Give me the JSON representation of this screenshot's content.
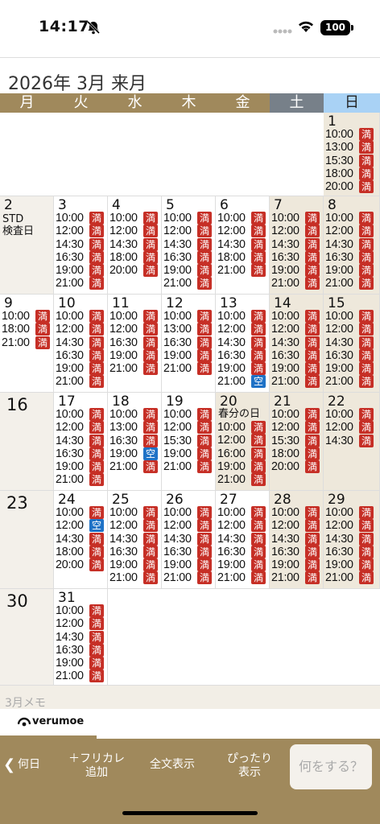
{
  "status_bar": {
    "time": "14:17",
    "battery": "100"
  },
  "calendar": {
    "title": "2026年 3月 来月",
    "weekdays": [
      "月",
      "火",
      "水",
      "木",
      "金",
      "土",
      "日"
    ],
    "weeks": [
      [
        null,
        null,
        null,
        null,
        null,
        null,
        {
          "day": "1",
          "slots": [
            [
              "10:00",
              "満"
            ],
            [
              "13:00",
              "満"
            ],
            [
              "15:30",
              "満"
            ],
            [
              "18:00",
              "満"
            ],
            [
              "20:00",
              "満"
            ]
          ]
        }
      ],
      [
        {
          "day": "2",
          "note": "STD\n検査日",
          "slots": []
        },
        {
          "day": "3",
          "slots": [
            [
              "10:00",
              "満"
            ],
            [
              "12:00",
              "満"
            ],
            [
              "14:30",
              "満"
            ],
            [
              "16:30",
              "満"
            ],
            [
              "19:00",
              "満"
            ],
            [
              "21:00",
              "満"
            ]
          ]
        },
        {
          "day": "4",
          "slots": [
            [
              "10:00",
              "満"
            ],
            [
              "12:00",
              "満"
            ],
            [
              "14:30",
              "満"
            ],
            [
              "18:00",
              "満"
            ],
            [
              "20:00",
              "満"
            ]
          ]
        },
        {
          "day": "5",
          "slots": [
            [
              "10:00",
              "満"
            ],
            [
              "12:00",
              "満"
            ],
            [
              "14:30",
              "満"
            ],
            [
              "16:30",
              "満"
            ],
            [
              "19:00",
              "満"
            ],
            [
              "21:00",
              "満"
            ]
          ]
        },
        {
          "day": "6",
          "slots": [
            [
              "10:00",
              "満"
            ],
            [
              "12:00",
              "満"
            ],
            [
              "14:30",
              "満"
            ],
            [
              "18:00",
              "満"
            ],
            [
              "21:00",
              "満"
            ]
          ]
        },
        {
          "day": "7",
          "slots": [
            [
              "10:00",
              "満"
            ],
            [
              "12:00",
              "満"
            ],
            [
              "14:30",
              "満"
            ],
            [
              "16:30",
              "満"
            ],
            [
              "19:00",
              "満"
            ],
            [
              "21:00",
              "満"
            ]
          ]
        },
        {
          "day": "8",
          "slots": [
            [
              "10:00",
              "満"
            ],
            [
              "12:00",
              "満"
            ],
            [
              "14:30",
              "満"
            ],
            [
              "16:30",
              "満"
            ],
            [
              "19:00",
              "満"
            ],
            [
              "21:00",
              "満"
            ]
          ]
        }
      ],
      [
        {
          "day": "9",
          "slots": [
            [
              "10:00",
              "満"
            ],
            [
              "18:00",
              "満"
            ],
            [
              "21:00",
              "満"
            ]
          ]
        },
        {
          "day": "10",
          "slots": [
            [
              "10:00",
              "満"
            ],
            [
              "12:00",
              "満"
            ],
            [
              "14:30",
              "満"
            ],
            [
              "16:30",
              "満"
            ],
            [
              "19:00",
              "満"
            ],
            [
              "21:00",
              "満"
            ]
          ]
        },
        {
          "day": "11",
          "slots": [
            [
              "10:00",
              "満"
            ],
            [
              "12:00",
              "満"
            ],
            [
              "16:30",
              "満"
            ],
            [
              "19:00",
              "満"
            ],
            [
              "21:00",
              "満"
            ]
          ]
        },
        {
          "day": "12",
          "slots": [
            [
              "10:00",
              "満"
            ],
            [
              "13:00",
              "満"
            ],
            [
              "16:30",
              "満"
            ],
            [
              "19:00",
              "満"
            ],
            [
              "21:00",
              "満"
            ]
          ]
        },
        {
          "day": "13",
          "slots": [
            [
              "10:00",
              "満"
            ],
            [
              "12:00",
              "満"
            ],
            [
              "14:30",
              "満"
            ],
            [
              "16:30",
              "満"
            ],
            [
              "19:00",
              "満"
            ],
            [
              "21:00",
              "空"
            ]
          ]
        },
        {
          "day": "14",
          "slots": [
            [
              "10:00",
              "満"
            ],
            [
              "12:00",
              "満"
            ],
            [
              "14:30",
              "満"
            ],
            [
              "16:30",
              "満"
            ],
            [
              "19:00",
              "満"
            ],
            [
              "21:00",
              "満"
            ]
          ]
        },
        {
          "day": "15",
          "slots": [
            [
              "10:00",
              "満"
            ],
            [
              "12:00",
              "満"
            ],
            [
              "14:30",
              "満"
            ],
            [
              "16:30",
              "満"
            ],
            [
              "19:00",
              "満"
            ],
            [
              "21:00",
              "満"
            ]
          ]
        }
      ],
      [
        {
          "day": "16",
          "slots": []
        },
        {
          "day": "17",
          "slots": [
            [
              "10:00",
              "満"
            ],
            [
              "12:00",
              "満"
            ],
            [
              "14:30",
              "満"
            ],
            [
              "16:30",
              "満"
            ],
            [
              "19:00",
              "満"
            ],
            [
              "21:00",
              "満"
            ]
          ]
        },
        {
          "day": "18",
          "slots": [
            [
              "10:00",
              "満"
            ],
            [
              "13:00",
              "満"
            ],
            [
              "16:30",
              "満"
            ],
            [
              "19:00",
              "空"
            ],
            [
              "21:00",
              "満"
            ]
          ]
        },
        {
          "day": "19",
          "slots": [
            [
              "10:00",
              "満"
            ],
            [
              "12:00",
              "満"
            ],
            [
              "15:30",
              "満"
            ],
            [
              "19:00",
              "満"
            ],
            [
              "21:00",
              "満"
            ]
          ]
        },
        {
          "day": "20",
          "note": "春分の日",
          "slots": [
            [
              "10:00",
              "満"
            ],
            [
              "12:00",
              "満"
            ],
            [
              "16:00",
              "満"
            ],
            [
              "19:00",
              "満"
            ],
            [
              "21:00",
              "満"
            ]
          ]
        },
        {
          "day": "21",
          "slots": [
            [
              "10:00",
              "満"
            ],
            [
              "12:00",
              "満"
            ],
            [
              "15:30",
              "満"
            ],
            [
              "18:00",
              "満"
            ],
            [
              "20:00",
              "満"
            ]
          ]
        },
        {
          "day": "22",
          "slots": [
            [
              "10:00",
              "満"
            ],
            [
              "12:00",
              "満"
            ],
            [
              "14:30",
              "満"
            ]
          ]
        }
      ],
      [
        {
          "day": "23",
          "slots": []
        },
        {
          "day": "24",
          "slots": [
            [
              "10:00",
              "満"
            ],
            [
              "12:00",
              "空"
            ],
            [
              "14:30",
              "満"
            ],
            [
              "18:00",
              "満"
            ],
            [
              "20:00",
              "満"
            ]
          ]
        },
        {
          "day": "25",
          "slots": [
            [
              "10:00",
              "満"
            ],
            [
              "12:00",
              "満"
            ],
            [
              "14:30",
              "満"
            ],
            [
              "16:30",
              "満"
            ],
            [
              "19:00",
              "満"
            ],
            [
              "21:00",
              "満"
            ]
          ]
        },
        {
          "day": "26",
          "slots": [
            [
              "10:00",
              "満"
            ],
            [
              "12:00",
              "満"
            ],
            [
              "14:30",
              "満"
            ],
            [
              "16:30",
              "満"
            ],
            [
              "19:00",
              "満"
            ],
            [
              "21:00",
              "満"
            ]
          ]
        },
        {
          "day": "27",
          "slots": [
            [
              "10:00",
              "満"
            ],
            [
              "12:00",
              "満"
            ],
            [
              "14:30",
              "満"
            ],
            [
              "16:30",
              "満"
            ],
            [
              "19:00",
              "満"
            ],
            [
              "21:00",
              "満"
            ]
          ]
        },
        {
          "day": "28",
          "slots": [
            [
              "10:00",
              "満"
            ],
            [
              "12:00",
              "満"
            ],
            [
              "14:30",
              "満"
            ],
            [
              "16:30",
              "満"
            ],
            [
              "19:00",
              "満"
            ],
            [
              "21:00",
              "満"
            ]
          ]
        },
        {
          "day": "29",
          "slots": [
            [
              "10:00",
              "満"
            ],
            [
              "12:00",
              "満"
            ],
            [
              "14:30",
              "満"
            ],
            [
              "16:30",
              "満"
            ],
            [
              "19:00",
              "満"
            ],
            [
              "21:00",
              "満"
            ]
          ]
        }
      ],
      [
        {
          "day": "30",
          "slots": []
        },
        {
          "day": "31",
          "slots": [
            [
              "10:00",
              "満"
            ],
            [
              "12:00",
              "満"
            ],
            [
              "14:30",
              "満"
            ],
            [
              "16:30",
              "満"
            ],
            [
              "19:00",
              "満"
            ],
            [
              "21:00",
              "満"
            ]
          ]
        },
        null,
        null,
        null,
        null,
        null
      ]
    ],
    "memo_label": "3月メモ"
  },
  "brand": {
    "name": "verumoe"
  },
  "toolbar": {
    "back_label": "何日",
    "furigana_label": "＋フリカレ\n追加",
    "fulltext_label": "全文表示",
    "fit_label": "ぴったり\n表示",
    "action_label": "何をする？"
  },
  "colors": {
    "accent": "#a0895c",
    "full_badge": "#c62f26",
    "open_badge": "#1f72c6",
    "sunday": "#a9d2f5",
    "saturday": "#778089"
  },
  "icons": [
    "bell-slash-icon",
    "wifi-icon",
    "battery-icon",
    "chevron-left-icon",
    "verumoe-logo-icon"
  ]
}
